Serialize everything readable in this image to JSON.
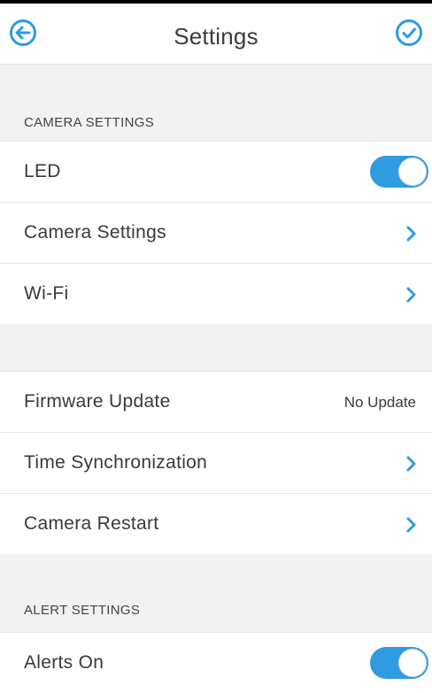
{
  "header": {
    "title": "Settings",
    "back_icon": "arrow-left-circle-icon",
    "done_icon": "check-circle-icon"
  },
  "colors": {
    "accent": "#2f9be0",
    "section_background": "#f2f2f2",
    "divider": "#e6e6e6",
    "text": "#3a3a3a"
  },
  "sections": {
    "camera_settings_header": "CAMERA SETTINGS",
    "alert_settings_header": "ALERT SETTINGS"
  },
  "rows": {
    "led": {
      "label": "LED",
      "toggle_on": true
    },
    "camera_settings": {
      "label": "Camera Settings",
      "icon": "chevron-right-icon"
    },
    "wifi": {
      "label": "Wi-Fi",
      "icon": "chevron-right-icon"
    },
    "firmware_update": {
      "label": "Firmware Update",
      "value": "No Update"
    },
    "time_sync": {
      "label": "Time Synchronization",
      "icon": "chevron-right-icon"
    },
    "camera_restart": {
      "label": "Camera Restart",
      "icon": "chevron-right-icon"
    },
    "alerts_on": {
      "label": "Alerts On",
      "toggle_on": true
    }
  }
}
